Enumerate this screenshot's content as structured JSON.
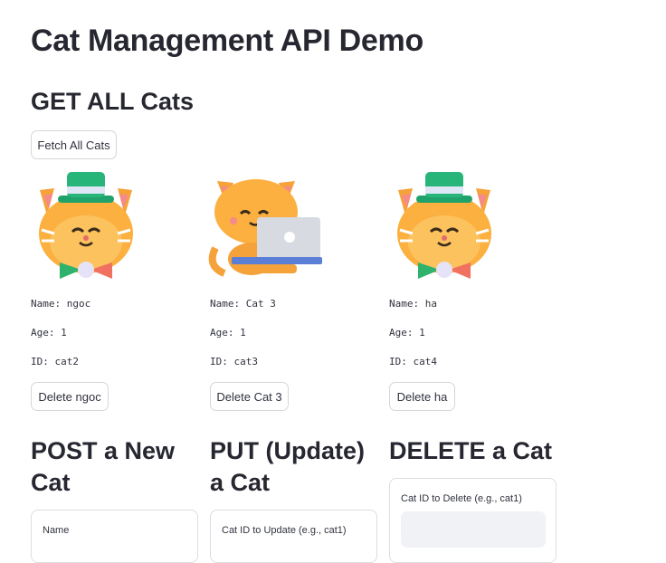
{
  "title": "Cat Management API Demo",
  "get_section": {
    "heading": "GET ALL Cats",
    "fetch_button": "Fetch All Cats"
  },
  "cats": [
    {
      "image_icon": "cat-with-hat-icon",
      "name": "Name: ngoc",
      "age": "Age: 1",
      "id": "ID: cat2",
      "delete_button": "Delete ngoc"
    },
    {
      "image_icon": "cat-with-laptop-icon",
      "name": "Name: Cat 3",
      "age": "Age: 1",
      "id": "ID: cat3",
      "delete_button": "Delete Cat 3"
    },
    {
      "image_icon": "cat-with-hat-icon",
      "name": "Name: ha",
      "age": "Age: 1",
      "id": "ID: cat4",
      "delete_button": "Delete ha"
    }
  ],
  "post_section": {
    "heading_line1": "POST a New",
    "heading_line2": "Cat",
    "field_label": "Name"
  },
  "put_section": {
    "heading_line1": "PUT (Update)",
    "heading_line2": "a Cat",
    "field_label": "Cat ID to Update (e.g., cat1)"
  },
  "delete_section": {
    "heading": "DELETE a Cat",
    "field_label": "Cat ID to Delete (e.g., cat1)"
  },
  "colors": {
    "hat_green": "#1fa36b",
    "cat_orange": "#fbb040",
    "bow_red": "#f0715f",
    "laptop_gray": "#d7dae0",
    "laptop_blue": "#5b7fd6"
  }
}
